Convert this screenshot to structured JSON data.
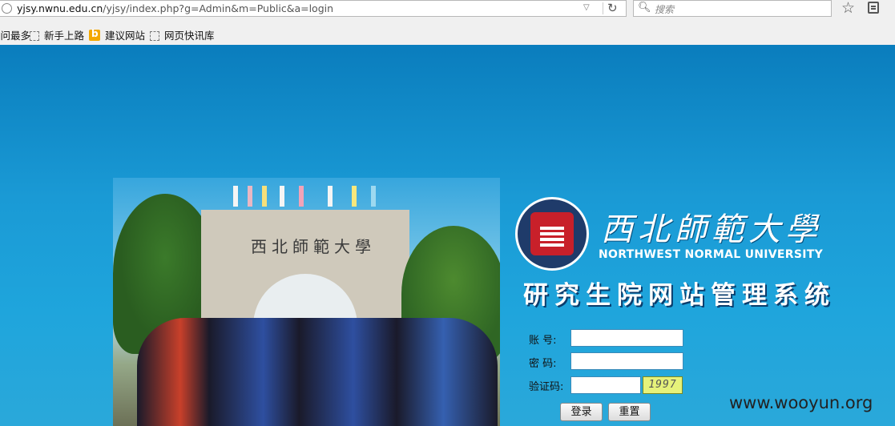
{
  "browser": {
    "url_host": "yjsy.nwnu.edu.cn",
    "url_path": "/yjsy/index.php?g=Admin&m=Public&a=login",
    "search_placeholder": "搜索",
    "bookmarks": [
      {
        "label": "访问最多",
        "icon": "folder-icon"
      },
      {
        "label": "新手上路",
        "icon": "dotted-page-icon"
      },
      {
        "label": "建议网站",
        "icon": "bing-icon"
      },
      {
        "label": "网页快讯库",
        "icon": "dotted-page-icon"
      }
    ]
  },
  "page": {
    "gate_inscription": "西北師範大學",
    "university_cn": "西北師範大學",
    "university_en": "NORTHWEST NORMAL UNIVERSITY",
    "system_title": "研究生院网站管理系统",
    "form": {
      "account_label": "账  号:",
      "password_label": "密  码:",
      "captcha_label": "验证码:",
      "account_value": "",
      "password_value": "",
      "captcha_value": "",
      "captcha_image_text": "1997"
    },
    "login_button": "登录",
    "reset_button": "重置",
    "watermark": "www.wooyun.org"
  },
  "colors": {
    "background": "#1a9ad5",
    "input_border": "#3a8ab8",
    "captcha_bg": "#e6f27a"
  }
}
